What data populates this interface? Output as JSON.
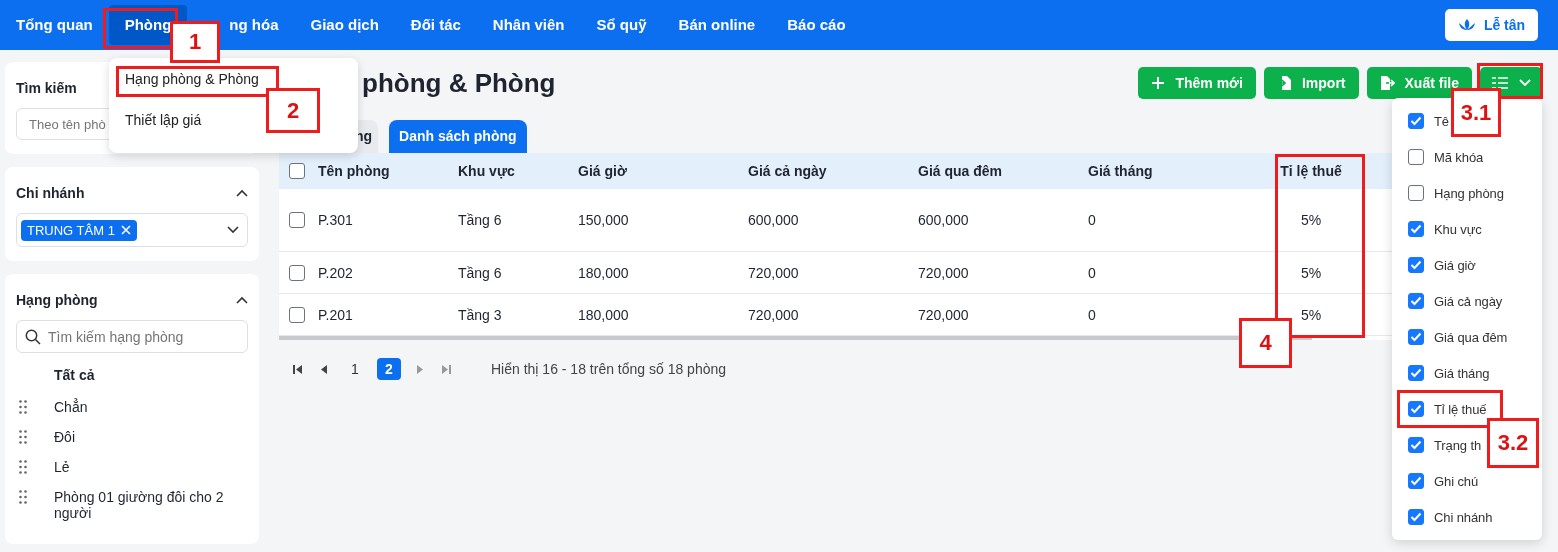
{
  "nav": {
    "items": [
      {
        "label": "Tổng quan",
        "selected": false
      },
      {
        "label": "Phòng",
        "selected": true
      },
      {
        "label": "ng hóa",
        "selected": false
      },
      {
        "label": "Giao dịch",
        "selected": false
      },
      {
        "label": "Đối tác",
        "selected": false
      },
      {
        "label": "Nhân viên",
        "selected": false
      },
      {
        "label": "Sổ quỹ",
        "selected": false
      },
      {
        "label": "Bán online",
        "selected": false
      },
      {
        "label": "Báo cáo",
        "selected": false
      }
    ],
    "reception_button": "Lễ tân"
  },
  "nav_menu": {
    "items": [
      "Hạng phòng & Phòng",
      "Thiết lập giá"
    ]
  },
  "sidebar": {
    "search": {
      "title": "Tìm kiếm",
      "placeholder": "Theo tên phò"
    },
    "branch": {
      "title": "Chi nhánh",
      "expanded": true,
      "tags": [
        "TRUNG TÂM 1"
      ]
    },
    "room_class": {
      "title": "Hạng phòng",
      "expanded": true,
      "placeholder": "Tìm kiếm hạng phòng",
      "all": "Tất cả",
      "items": [
        "Chẳn",
        "Đôi",
        "Lẻ",
        "Phòng 01 giường đôi cho 2 người"
      ]
    }
  },
  "page": {
    "title": "phòng & Phòng",
    "buttons": [
      {
        "label": "Thêm mới",
        "kind": "add"
      },
      {
        "label": "Import",
        "kind": "import"
      },
      {
        "label": "Xuất file",
        "kind": "export"
      }
    ],
    "tabs": [
      {
        "label": "ng",
        "selected": false
      },
      {
        "label": "Danh sách phòng",
        "selected": true
      }
    ]
  },
  "table": {
    "header_checked": false,
    "columns": [
      "Tên phòng",
      "Khu vực",
      "Giá giờ",
      "Giá cả ngày",
      "Giá qua đêm",
      "Giá tháng",
      "Tỉ lệ thuế"
    ],
    "rows": [
      {
        "checked": false,
        "cells": [
          "P.301",
          "Tầng 6",
          "150,000",
          "600,000",
          "600,000",
          "0",
          "5%"
        ]
      },
      {
        "checked": false,
        "cells": [
          "P.202",
          "Tầng 6",
          "180,000",
          "720,000",
          "720,000",
          "0",
          "5%"
        ]
      },
      {
        "checked": false,
        "cells": [
          "P.201",
          "Tầng 3",
          "180,000",
          "720,000",
          "720,000",
          "0",
          "5%"
        ]
      }
    ]
  },
  "pagination": {
    "pages": [
      {
        "label": "1",
        "selected": false
      },
      {
        "label": "2",
        "selected": true
      }
    ],
    "summary": "Hiển thị 16 - 18 trên tổng số 18 phòng"
  },
  "column_menu": {
    "items": [
      {
        "label": "Tê",
        "checked": true
      },
      {
        "label": "Mã khóa",
        "checked": false
      },
      {
        "label": "Hạng phòng",
        "checked": false
      },
      {
        "label": "Khu vực",
        "checked": true
      },
      {
        "label": "Giá giờ",
        "checked": true
      },
      {
        "label": "Giá cả ngày",
        "checked": true
      },
      {
        "label": "Giá qua đêm",
        "checked": true
      },
      {
        "label": "Giá tháng",
        "checked": true
      },
      {
        "label": "Tỉ lệ thuế",
        "checked": true
      },
      {
        "label": "Trạng th",
        "checked": true
      },
      {
        "label": "Ghi chú",
        "checked": true
      },
      {
        "label": "Chi nhánh",
        "checked": true
      }
    ]
  },
  "annotations": [
    {
      "label": "1"
    },
    {
      "label": "2"
    },
    {
      "label": "3.1"
    },
    {
      "label": "3.2"
    },
    {
      "label": "4"
    }
  ]
}
